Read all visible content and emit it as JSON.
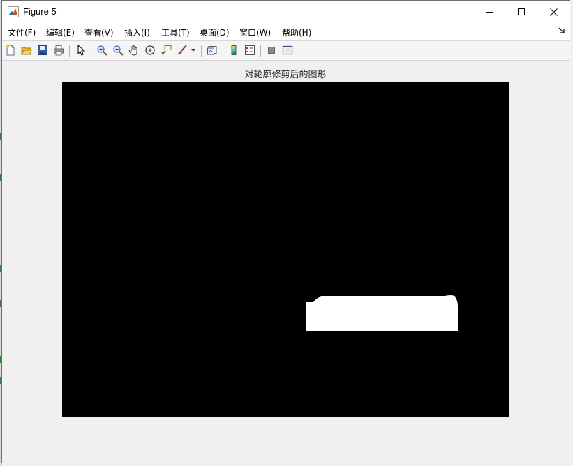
{
  "window": {
    "title": "Figure 5",
    "controls": {
      "minimize": "minimize",
      "maximize": "maximize",
      "close": "close"
    }
  },
  "menu": {
    "items": [
      {
        "label": "文件(F)"
      },
      {
        "label": "编辑(E)"
      },
      {
        "label": "查看(V)"
      },
      {
        "label": "插入(I)"
      },
      {
        "label": "工具(T)"
      },
      {
        "label": "桌面(D)"
      },
      {
        "label": "窗口(W)"
      },
      {
        "label": "帮助(H)"
      }
    ]
  },
  "toolbar": {
    "icons": [
      "new-figure-icon",
      "open-file-icon",
      "save-icon",
      "print-icon",
      "edit-plot-icon",
      "zoom-in-icon",
      "zoom-out-icon",
      "pan-icon",
      "rotate-3d-icon",
      "data-cursor-icon",
      "brush-icon",
      "brush-dropdown-icon",
      "link-plot-icon",
      "insert-colorbar-icon",
      "insert-legend-icon",
      "hide-plot-tools-icon",
      "show-plot-tools-icon"
    ]
  },
  "figure": {
    "axes_title": "对轮廓修剪后的图形",
    "background_color": "#f0f0f0",
    "image_background": "#000000",
    "foreground_color": "#ffffff"
  }
}
